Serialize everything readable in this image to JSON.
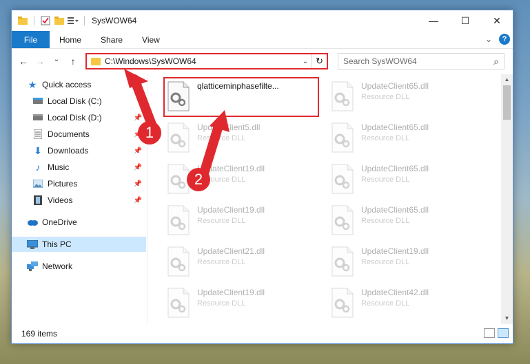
{
  "window": {
    "title": "SysWOW64"
  },
  "window_controls": {
    "minimize": "—",
    "maximize": "☐",
    "close": "✕"
  },
  "ribbon": {
    "tabs": [
      "File",
      "Home",
      "Share",
      "View"
    ],
    "expand": "⌄",
    "help": "?"
  },
  "nav": {
    "back": "←",
    "forward": "→",
    "recent": "⌄",
    "up": "↑"
  },
  "address": {
    "path": "C:\\Windows\\SysWOW64",
    "dropdown": "⌄",
    "refresh": "↻"
  },
  "search": {
    "placeholder": "Search SysWOW64",
    "icon": "⌕"
  },
  "sidebar": {
    "quick_access": "Quick access",
    "items": [
      {
        "label": "Local Disk (C:)",
        "icon": "drive-icon",
        "pinned": false
      },
      {
        "label": "Local Disk (D:)",
        "icon": "drive-icon",
        "pinned": true
      },
      {
        "label": "Documents",
        "icon": "documents-icon",
        "pinned": true
      },
      {
        "label": "Downloads",
        "icon": "downloads-icon",
        "pinned": true
      },
      {
        "label": "Music",
        "icon": "music-icon",
        "pinned": true
      },
      {
        "label": "Pictures",
        "icon": "pictures-icon",
        "pinned": true
      },
      {
        "label": "Videos",
        "icon": "videos-icon",
        "pinned": true
      }
    ],
    "onedrive": "OneDrive",
    "this_pc": "This PC",
    "network": "Network"
  },
  "files": {
    "highlighted": {
      "name": "qlatticeminphasefilte...",
      "type": ""
    },
    "left_column": [
      {
        "name": "UpdateClient5.dll",
        "type": "Resource DLL"
      },
      {
        "name": "UpdateClient19.dll",
        "type": "Resource DLL"
      },
      {
        "name": "UpdateClient19.dll",
        "type": "Resource DLL"
      },
      {
        "name": "UpdateClient21.dll",
        "type": "Resource DLL"
      },
      {
        "name": "UpdateClient19.dll",
        "type": "Resource DLL"
      }
    ],
    "right_column": [
      {
        "name": "UpdateClient65.dll",
        "type": "Resource DLL"
      },
      {
        "name": "UpdateClient65.dll",
        "type": "Resource DLL"
      },
      {
        "name": "UpdateClient65.dll",
        "type": "Resource DLL"
      },
      {
        "name": "UpdateClient65.dll",
        "type": "Resource DLL"
      },
      {
        "name": "UpdateClient19.dll",
        "type": "Resource DLL"
      },
      {
        "name": "UpdateClient42.dll",
        "type": "Resource DLL"
      }
    ]
  },
  "status": {
    "count": "169 items"
  },
  "annotations": {
    "step1": "1",
    "step2": "2",
    "color": "#e0292f"
  }
}
